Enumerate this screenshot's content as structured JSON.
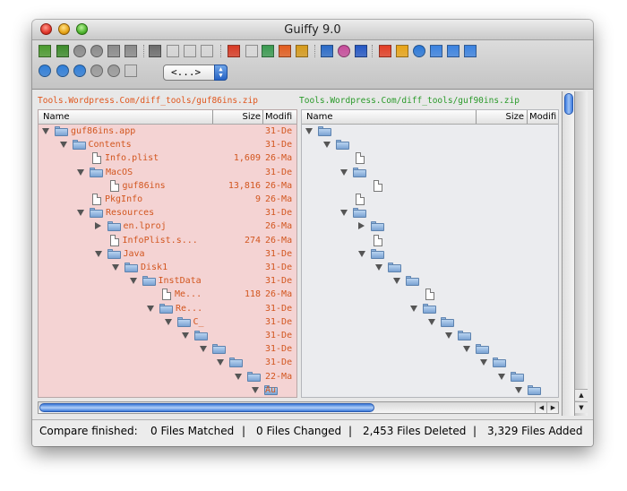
{
  "window": {
    "title": "Guiffy 9.0"
  },
  "toolbar": {
    "nav_select": "<...>"
  },
  "left": {
    "path": "Tools.Wordpress.Com/diff_tools/guf86ins.zip",
    "columns": {
      "name": "Name",
      "size": "Size",
      "modified": "Modifi"
    },
    "rows": [
      {
        "name": "guf86ins.app",
        "size": "",
        "mod": "31-De"
      },
      {
        "name": "Contents",
        "size": "",
        "mod": "31-De"
      },
      {
        "name": "Info.plist",
        "size": "1,609",
        "mod": "26-Ma"
      },
      {
        "name": "MacOS",
        "size": "",
        "mod": "31-De"
      },
      {
        "name": "guf86ins",
        "size": "13,816",
        "mod": "26-Ma"
      },
      {
        "name": "PkgInfo",
        "size": "9",
        "mod": "26-Ma"
      },
      {
        "name": "Resources",
        "size": "",
        "mod": "31-De"
      },
      {
        "name": "en.lproj",
        "size": "",
        "mod": "26-Ma"
      },
      {
        "name": "InfoPlist.s...",
        "size": "274",
        "mod": "26-Ma"
      },
      {
        "name": "Java",
        "size": "",
        "mod": "31-De"
      },
      {
        "name": "Disk1",
        "size": "",
        "mod": "31-De"
      },
      {
        "name": "InstData",
        "size": "",
        "mod": "31-De"
      },
      {
        "name": "Me...",
        "size": "118",
        "mod": "26-Ma"
      },
      {
        "name": "Re...",
        "size": "",
        "mod": "31-De"
      },
      {
        "name": "C_",
        "size": "",
        "mod": "31-De"
      },
      {
        "name": "",
        "size": "",
        "mod": "31-De"
      },
      {
        "name": "",
        "size": "",
        "mod": "31-De"
      },
      {
        "name": "",
        "size": "",
        "mod": "31-De"
      },
      {
        "name": "",
        "size": "",
        "mod": "22-Ma"
      },
      {
        "name": "",
        "size": "",
        "mod": "Au"
      }
    ]
  },
  "right": {
    "path": "Tools.Wordpress.Com/diff_tools/guf90ins.zip",
    "columns": {
      "name": "Name",
      "size": "Size",
      "modified": "Modifi"
    }
  },
  "status": {
    "compare": "Compare finished:",
    "matched": "0 Files Matched",
    "changed": "0 Files Changed",
    "deleted": "2,453 Files Deleted",
    "added": "3,329 Files Added",
    "divider": "|"
  }
}
